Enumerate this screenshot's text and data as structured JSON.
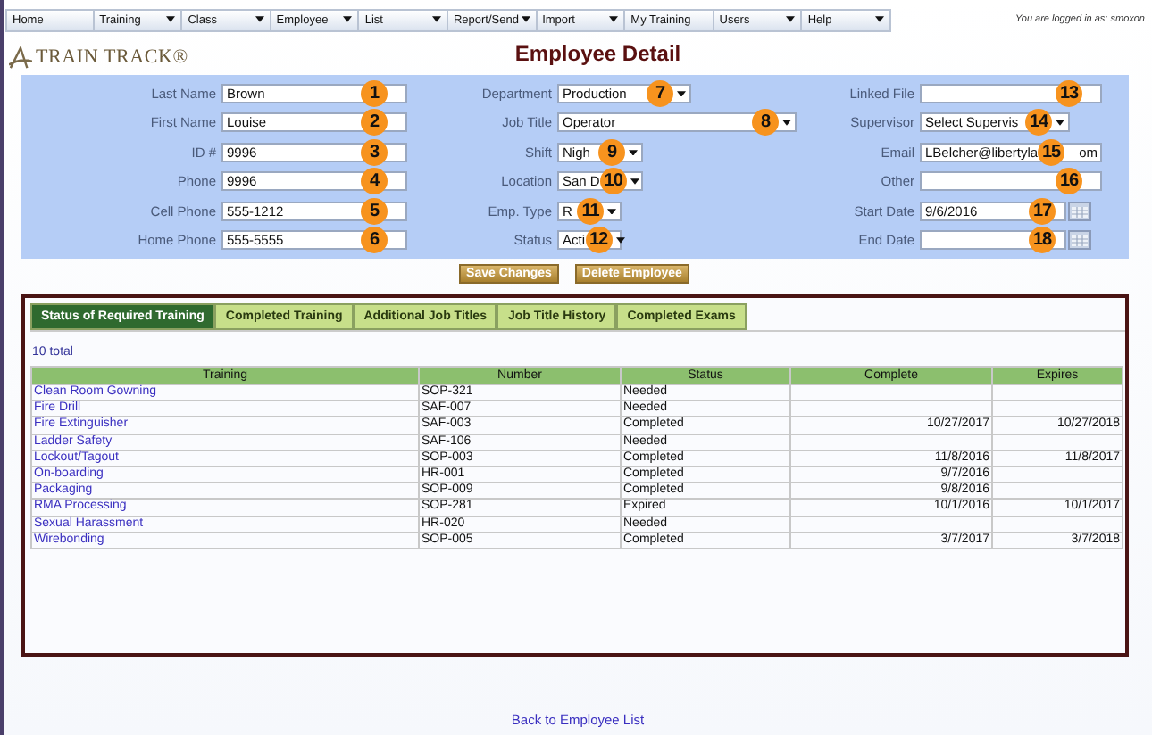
{
  "menu": [
    {
      "label": "Home",
      "dropdown": false
    },
    {
      "label": "Training",
      "dropdown": true
    },
    {
      "label": "Class",
      "dropdown": true
    },
    {
      "label": "Employee",
      "dropdown": true
    },
    {
      "label": "List",
      "dropdown": true
    },
    {
      "label": "Report/Send",
      "dropdown": true
    },
    {
      "label": "Import",
      "dropdown": true
    },
    {
      "label": "My Training",
      "dropdown": false
    },
    {
      "label": "Users",
      "dropdown": true
    },
    {
      "label": "Help",
      "dropdown": true
    }
  ],
  "login_status": "You are logged in as: smoxon",
  "logo": "TRAIN TRACK®",
  "title": "Employee Detail",
  "form_columns": [
    [
      {
        "label": "Last Name",
        "kind": "text",
        "value": "Brown",
        "callout": "1"
      },
      {
        "label": "First Name",
        "kind": "text",
        "value": "Louise",
        "callout": "2"
      },
      {
        "label": "ID #",
        "kind": "text",
        "value": "9996",
        "callout": "3"
      },
      {
        "label": "Phone",
        "kind": "text",
        "value": "9996",
        "callout": "4"
      },
      {
        "label": "Cell Phone",
        "kind": "text",
        "value": "555-1212",
        "callout": "5"
      },
      {
        "label": "Home Phone",
        "kind": "text",
        "value": "555-5555",
        "callout": "6"
      }
    ],
    [
      {
        "label": "Department",
        "kind": "select",
        "value": "Production",
        "callout": "7"
      },
      {
        "label": "Job Title",
        "kind": "select",
        "value": "Operator",
        "callout": "8"
      },
      {
        "label": "Shift",
        "kind": "select",
        "value": "Nigh",
        "callout": "9"
      },
      {
        "label": "Location",
        "kind": "select",
        "value": "San D",
        "callout": "10"
      },
      {
        "label": "Emp. Type",
        "kind": "select",
        "value": "R",
        "callout": "11"
      },
      {
        "label": "Status",
        "kind": "select",
        "value": "Acti",
        "callout": "12"
      }
    ],
    [
      {
        "label": "Linked File",
        "kind": "text",
        "callout": "13"
      },
      {
        "label": "Supervisor",
        "kind": "select",
        "value": "Select Supervis",
        "callout": "14"
      },
      {
        "label": "Email",
        "kind": "text",
        "value": "LBelcher@libertyla",
        "tail": "om",
        "callout": "15"
      },
      {
        "label": "Other",
        "kind": "text",
        "callout": "16"
      },
      {
        "label": "Start Date",
        "kind": "date",
        "value": "9/6/2016",
        "callout": "17"
      },
      {
        "label": "End Date",
        "kind": "date",
        "callout": "18"
      }
    ]
  ],
  "buttons": [
    "Save Changes",
    "Delete Employee"
  ],
  "tabs": [
    {
      "label": "Status of Required Training",
      "selected": true
    },
    {
      "label": "Completed Training",
      "selected": false
    },
    {
      "label": "Additional Job Titles",
      "selected": false
    },
    {
      "label": "Job Title History",
      "selected": false
    },
    {
      "label": "Completed Exams",
      "selected": false
    }
  ],
  "total": "10 total",
  "table": {
    "columns": [
      "Training",
      "Number",
      "Status",
      "Complete",
      "Expires"
    ],
    "rows": [
      {
        "training": "Clean Room Gowning",
        "number": "SOP-321",
        "status": "Needed"
      },
      {
        "training": "Fire Drill",
        "number": "SAF-007",
        "status": "Needed"
      },
      {
        "training": "Fire Extinguisher",
        "number": "SAF-003",
        "status": "Completed",
        "complete": "10/27/2017",
        "expires": "10/27/2018"
      },
      {
        "training": "Ladder Safety",
        "number": "SAF-106",
        "status": "Needed"
      },
      {
        "training": "Lockout/Tagout",
        "number": "SOP-003",
        "status": "Completed",
        "complete": "11/8/2016",
        "expires": "11/8/2017"
      },
      {
        "training": "On-boarding",
        "number": "HR-001",
        "status": "Completed",
        "complete": "9/7/2016"
      },
      {
        "training": "Packaging",
        "number": "SOP-009",
        "status": "Completed",
        "complete": "9/8/2016"
      },
      {
        "training": "RMA Processing",
        "number": "SOP-281",
        "status": "Expired",
        "complete": "10/1/2016",
        "expires": "10/1/2017"
      },
      {
        "training": "Sexual Harassment",
        "number": "HR-020",
        "status": "Needed"
      },
      {
        "training": "Wirebonding",
        "number": "SOP-005",
        "status": "Completed",
        "complete": "3/7/2017",
        "expires": "3/7/2018"
      }
    ]
  },
  "back_link": "Back to Employee List"
}
